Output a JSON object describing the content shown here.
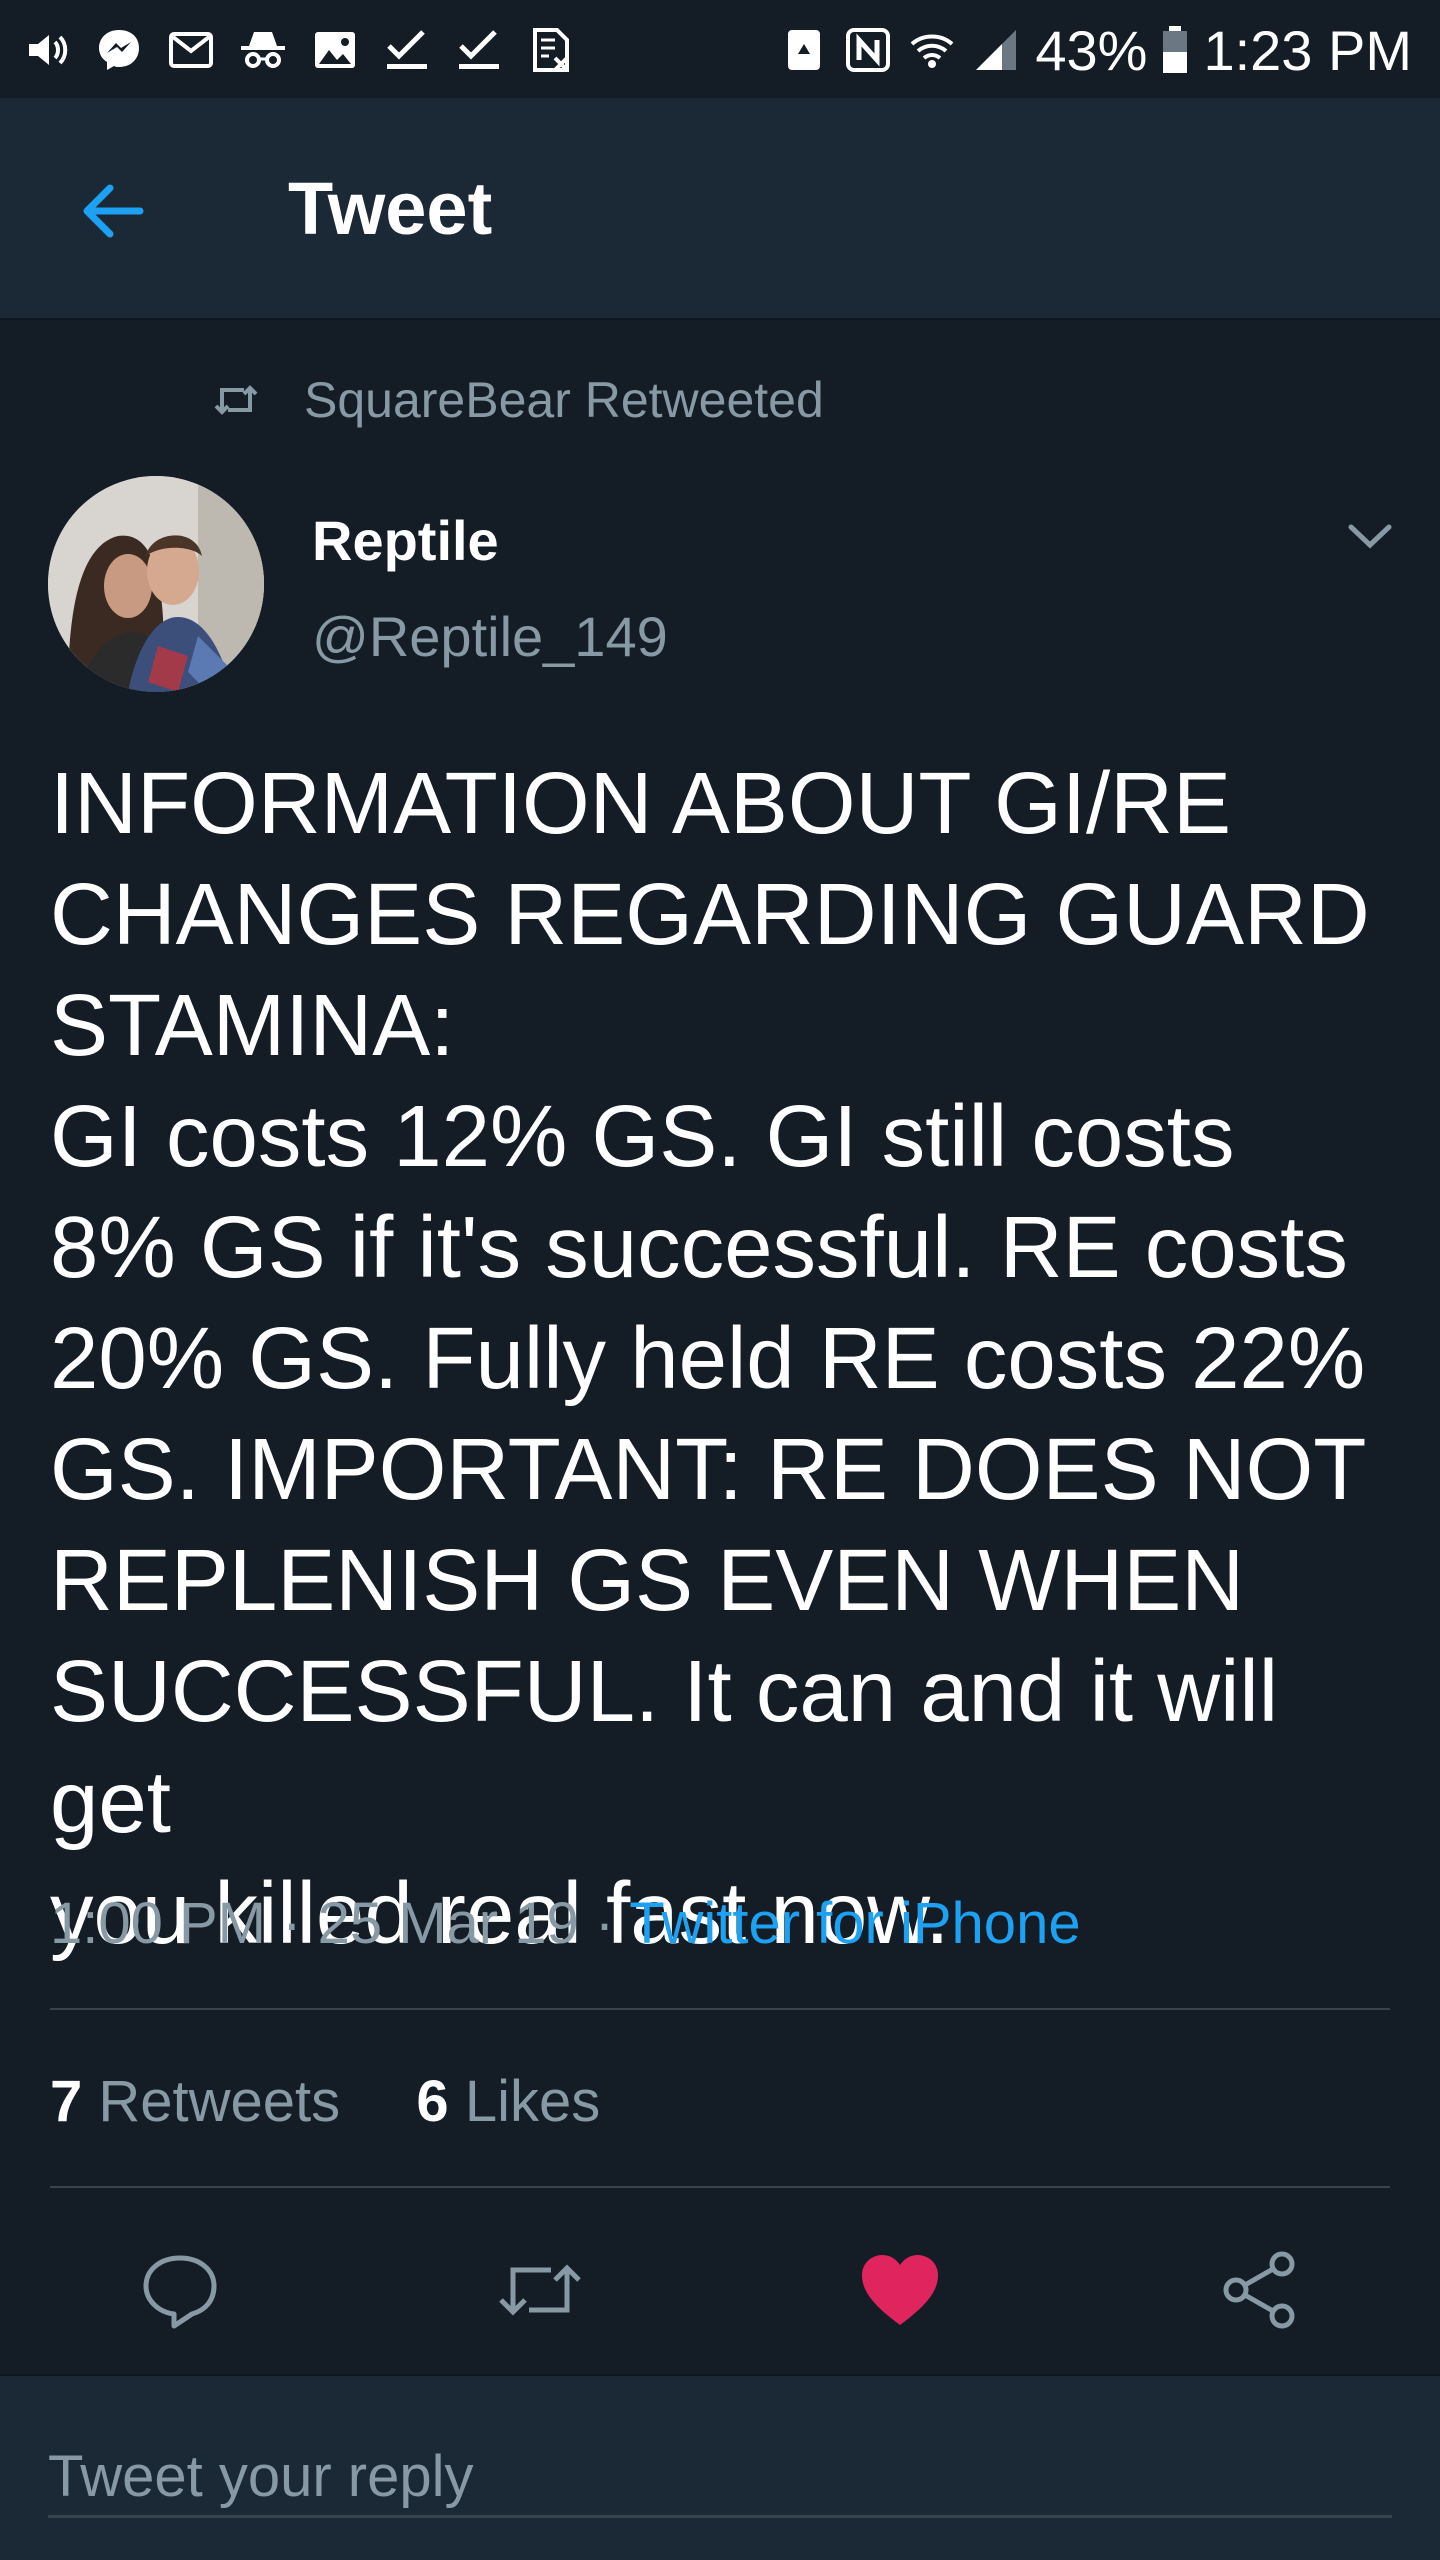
{
  "status_bar": {
    "left_icons": [
      "volume-icon",
      "messenger-icon",
      "email-icon",
      "incognito-icon",
      "gallery-icon",
      "check-icon",
      "check-icon",
      "no-sim-icon"
    ],
    "battery_percent": "43%",
    "time": "1:23 PM"
  },
  "app_bar": {
    "title": "Tweet",
    "back_icon": "arrow-left-icon"
  },
  "tweet": {
    "retweet_context": "SquareBear Retweeted",
    "author_name": "Reptile",
    "author_handle": "@Reptile_149",
    "text": "INFORMATION ABOUT GI/RE\nCHANGES REGARDING GUARD\nSTAMINA:\nGI costs 12% GS. GI still costs\n8% GS if it's successful. RE costs\n20% GS. Fully held RE costs 22%\nGS. IMPORTANT: RE DOES NOT\nREPLENISH GS EVEN WHEN\nSUCCESSFUL. It can and it will get\nyou killed real fast now.",
    "time": "1:00 PM",
    "date": "25 Mar 19",
    "separator": "·",
    "source": "Twitter for iPhone",
    "retweets_count": "7",
    "retweets_label": "Retweets",
    "likes_count": "6",
    "likes_label": "Likes",
    "liked": true
  },
  "colors": {
    "background": "#141d26",
    "bar": "#1b2836",
    "secondary_text": "#8899a6",
    "link": "#1da1f2",
    "like": "#e0245e"
  },
  "reply": {
    "placeholder": "Tweet your reply"
  }
}
